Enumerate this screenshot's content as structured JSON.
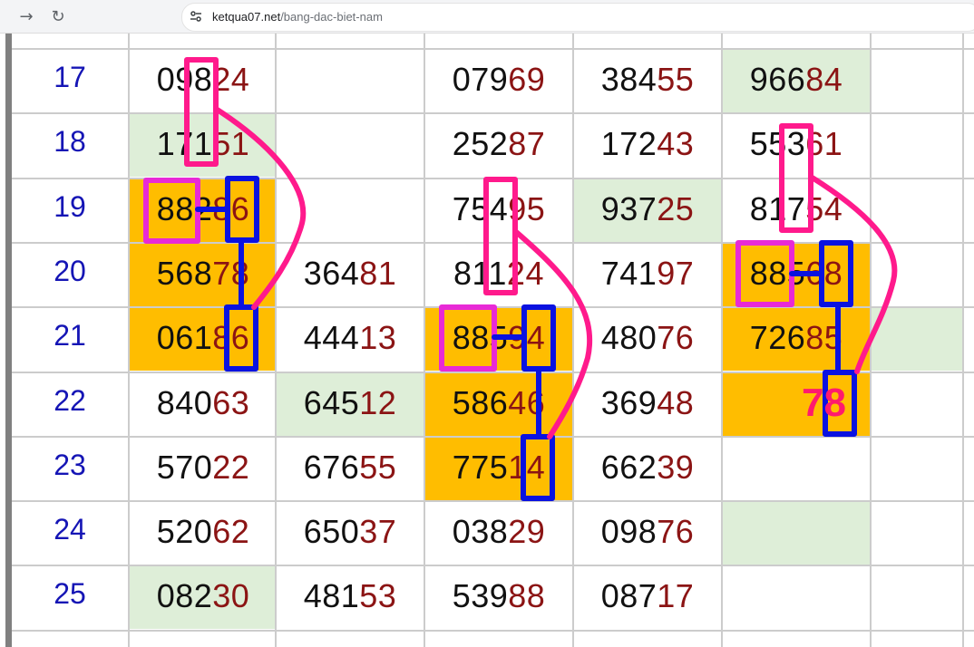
{
  "browser": {
    "back_icon": "arrow-right-icon",
    "reload_icon": "reload-icon",
    "url_host": "ketqua07.net",
    "url_path": "/bang-dac-biet-nam"
  },
  "table": {
    "rows": [
      {
        "day": "17",
        "cells": [
          {
            "head": "098",
            "tail": "24",
            "bg": "none"
          },
          {
            "head": "",
            "tail": "",
            "bg": "none"
          },
          {
            "head": "079",
            "tail": "69",
            "bg": "none"
          },
          {
            "head": "384",
            "tail": "55",
            "bg": "none"
          },
          {
            "head": "966",
            "tail": "84",
            "bg": "green"
          },
          {
            "head": "",
            "tail": "",
            "bg": "none"
          }
        ]
      },
      {
        "day": "18",
        "cells": [
          {
            "head": "171",
            "tail": "51",
            "bg": "green"
          },
          {
            "head": "",
            "tail": "",
            "bg": "none"
          },
          {
            "head": "252",
            "tail": "87",
            "bg": "none"
          },
          {
            "head": "172",
            "tail": "43",
            "bg": "none"
          },
          {
            "head": "553",
            "tail": "61",
            "bg": "none"
          },
          {
            "head": "",
            "tail": "",
            "bg": "none"
          }
        ]
      },
      {
        "day": "19",
        "cells": [
          {
            "head": "882",
            "tail": "86",
            "bg": "orange"
          },
          {
            "head": "",
            "tail": "",
            "bg": "none"
          },
          {
            "head": "754",
            "tail": "95",
            "bg": "none"
          },
          {
            "head": "937",
            "tail": "25",
            "bg": "green"
          },
          {
            "head": "817",
            "tail": "54",
            "bg": "none"
          },
          {
            "head": "",
            "tail": "",
            "bg": "none"
          }
        ]
      },
      {
        "day": "20",
        "cells": [
          {
            "head": "568",
            "tail": "78",
            "bg": "orange"
          },
          {
            "head": "364",
            "tail": "81",
            "bg": "none"
          },
          {
            "head": "811",
            "tail": "24",
            "bg": "none"
          },
          {
            "head": "741",
            "tail": "97",
            "bg": "none"
          },
          {
            "head": "885",
            "tail": "68",
            "bg": "orange"
          },
          {
            "head": "",
            "tail": "",
            "bg": "none"
          }
        ]
      },
      {
        "day": "21",
        "cells": [
          {
            "head": "061",
            "tail": "86",
            "bg": "orange"
          },
          {
            "head": "444",
            "tail": "13",
            "bg": "none"
          },
          {
            "head": "885",
            "tail": "94",
            "bg": "orange"
          },
          {
            "head": "480",
            "tail": "76",
            "bg": "none"
          },
          {
            "head": "726",
            "tail": "85",
            "bg": "orange"
          },
          {
            "head": "",
            "tail": "",
            "bg": "green"
          }
        ]
      },
      {
        "day": "22",
        "cells": [
          {
            "head": "840",
            "tail": "63",
            "bg": "none"
          },
          {
            "head": "645",
            "tail": "12",
            "bg": "green"
          },
          {
            "head": "586",
            "tail": "46",
            "bg": "orange"
          },
          {
            "head": "369",
            "tail": "48",
            "bg": "none"
          },
          {
            "head": "",
            "tail": "",
            "bg": "orange"
          },
          {
            "head": "",
            "tail": "",
            "bg": "none"
          }
        ]
      },
      {
        "day": "23",
        "cells": [
          {
            "head": "570",
            "tail": "22",
            "bg": "none"
          },
          {
            "head": "676",
            "tail": "55",
            "bg": "none"
          },
          {
            "head": "775",
            "tail": "14",
            "bg": "orange"
          },
          {
            "head": "662",
            "tail": "39",
            "bg": "none"
          },
          {
            "head": "",
            "tail": "",
            "bg": "none"
          },
          {
            "head": "",
            "tail": "",
            "bg": "none"
          }
        ]
      },
      {
        "day": "24",
        "cells": [
          {
            "head": "520",
            "tail": "62",
            "bg": "none"
          },
          {
            "head": "650",
            "tail": "37",
            "bg": "none"
          },
          {
            "head": "038",
            "tail": "29",
            "bg": "none"
          },
          {
            "head": "098",
            "tail": "76",
            "bg": "none"
          },
          {
            "head": "",
            "tail": "",
            "bg": "green"
          },
          {
            "head": "",
            "tail": "",
            "bg": "none"
          }
        ]
      },
      {
        "day": "25",
        "cells": [
          {
            "head": "082",
            "tail": "30",
            "bg": "green"
          },
          {
            "head": "481",
            "tail": "53",
            "bg": "none"
          },
          {
            "head": "539",
            "tail": "88",
            "bg": "none"
          },
          {
            "head": "087",
            "tail": "17",
            "bg": "none"
          },
          {
            "head": "",
            "tail": "",
            "bg": "none"
          },
          {
            "head": "",
            "tail": "",
            "bg": "none"
          }
        ]
      }
    ]
  },
  "annotation": {
    "prediction": "78"
  },
  "colors": {
    "green_cell": "#deeed8",
    "orange_cell": "#ffbd00",
    "day_text": "#1515b5",
    "tail_digits": "#8b1414",
    "annotation_pink": "#ff1a8c",
    "annotation_magenta": "#e82ad6",
    "annotation_blue": "#0a12e0"
  }
}
